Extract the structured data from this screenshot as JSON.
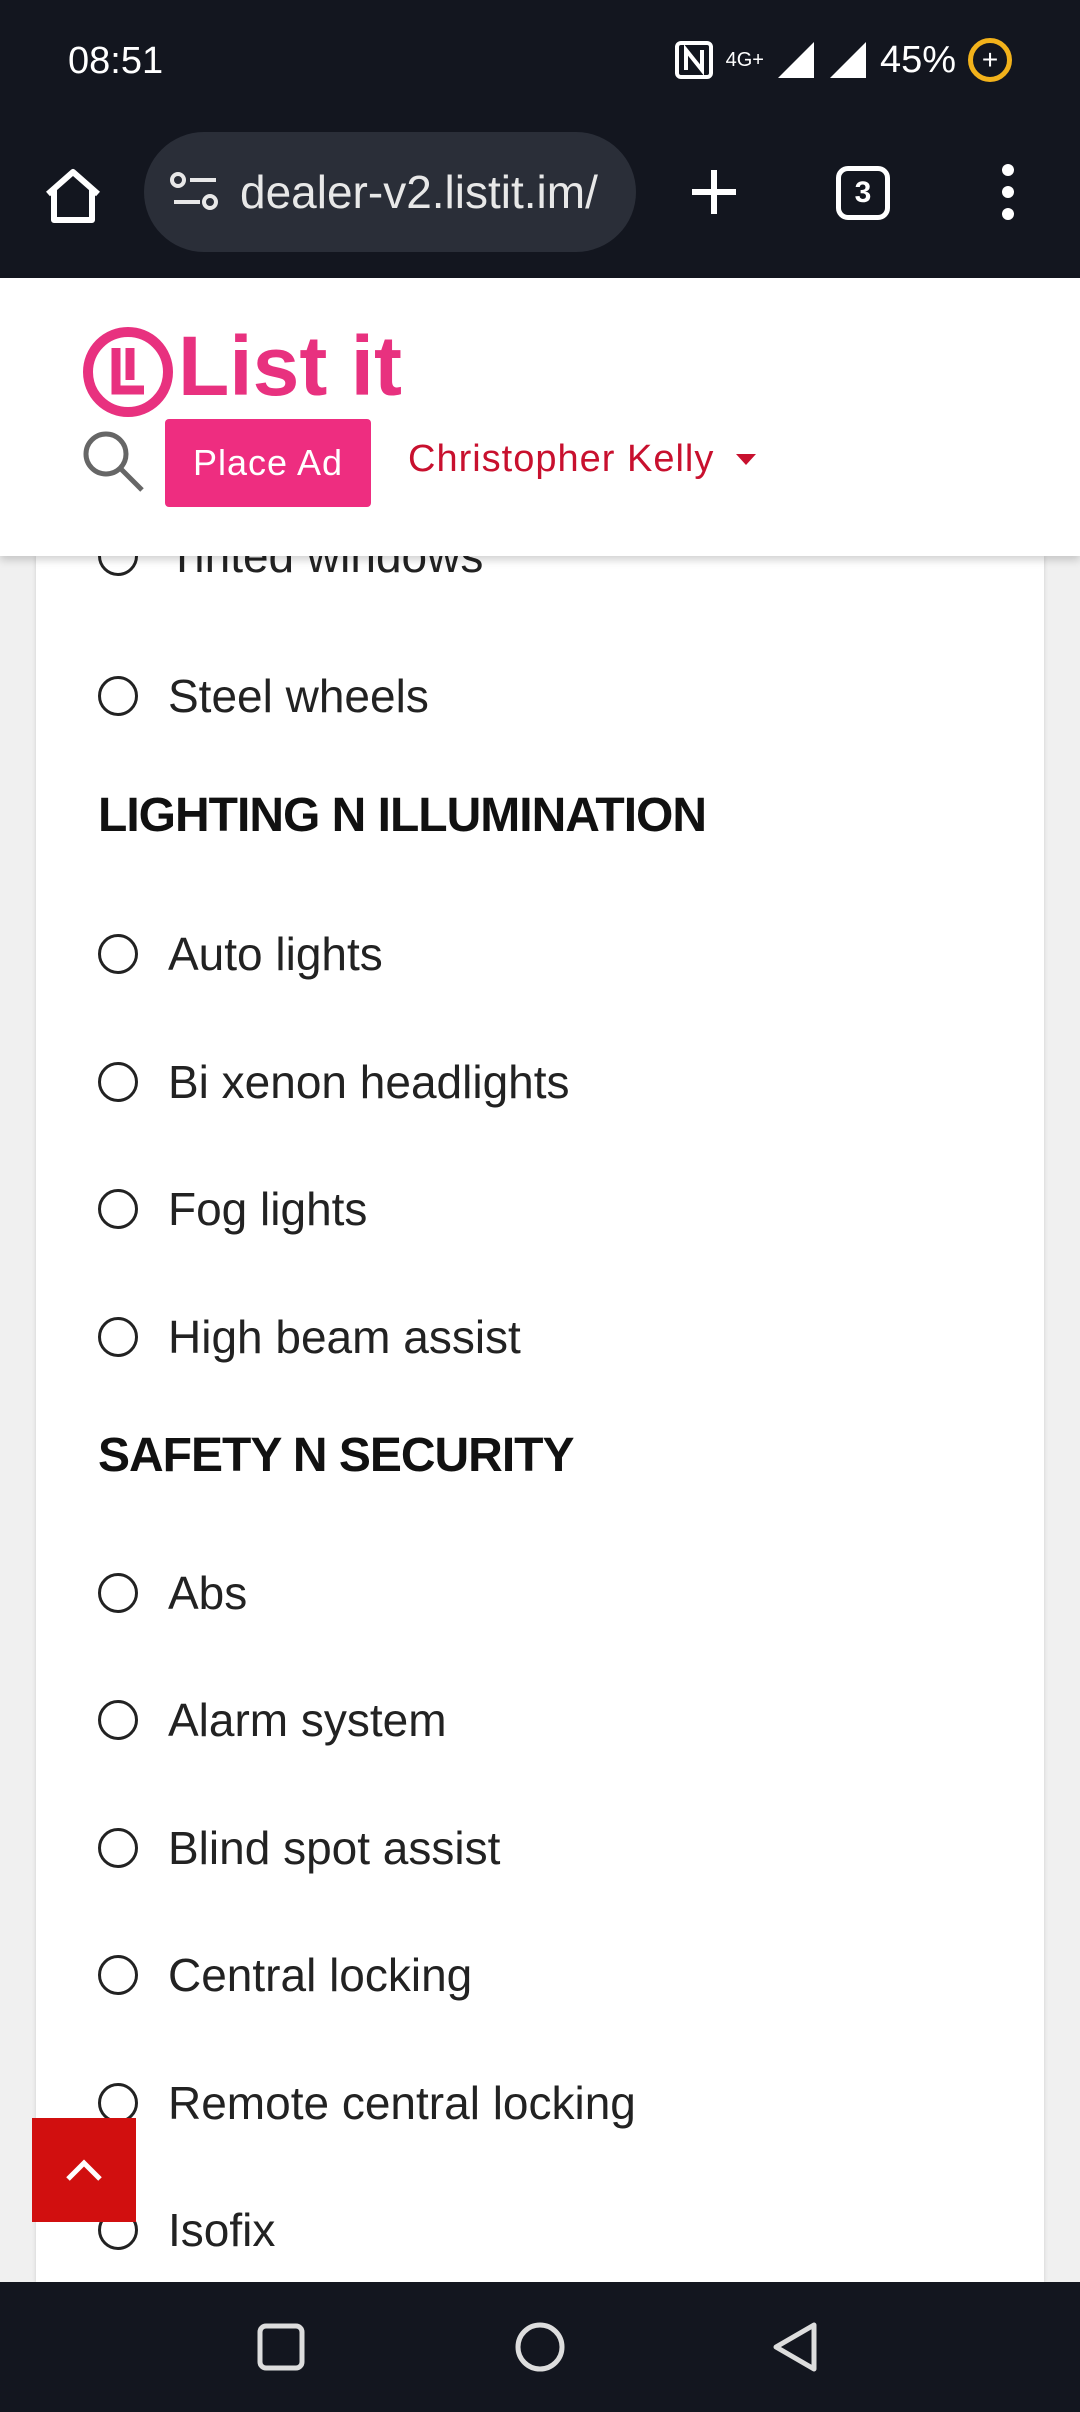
{
  "status_bar": {
    "time": "08:51",
    "network": "4G+",
    "battery": "45%"
  },
  "browser": {
    "url": "dealer-v2.listit.im/",
    "tab_count": "3"
  },
  "site": {
    "logo_text": "List it",
    "place_ad_label": "Place Ad",
    "user_name": "Christopher Kelly",
    "brand_color": "#e8317f"
  },
  "features": {
    "partial_item": "Tinted windows",
    "exterior_items": [
      "Steel wheels"
    ],
    "lighting": {
      "heading": "LIGHTING N ILLUMINATION",
      "items": [
        "Auto lights",
        "Bi xenon headlights",
        "Fog lights",
        "High beam assist"
      ]
    },
    "safety": {
      "heading": "SAFETY N SECURITY",
      "items": [
        "Abs",
        "Alarm system",
        "Blind spot assist",
        "Central locking",
        "Remote central locking",
        "Isofix"
      ]
    }
  },
  "icons": {
    "back_to_top": "chevron-up-icon",
    "accent_red": "#d10f0f"
  }
}
